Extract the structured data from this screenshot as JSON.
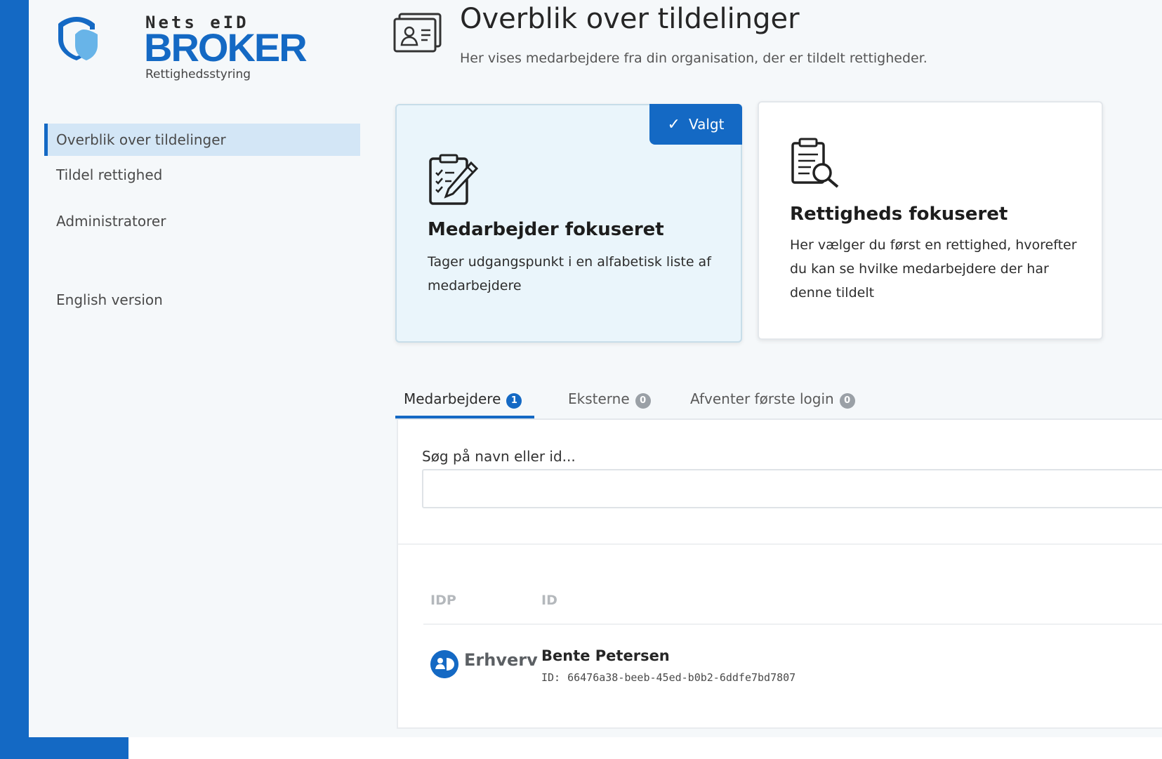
{
  "brand": {
    "top_text": "Nets eID",
    "name": "BROKER",
    "subtitle": "Rettighedsstyring",
    "color": "#1469c4"
  },
  "sidebar": {
    "items": [
      {
        "label": "Overblik over tildelinger",
        "active": true
      },
      {
        "label": "Tildel rettighed",
        "active": false
      },
      {
        "label": "Administratorer",
        "active": false
      },
      {
        "label": "English version",
        "active": false
      }
    ]
  },
  "header": {
    "icon": "id-card-icon",
    "title": "Overblik over tildelinger",
    "subtitle": "Her vises medarbejdere fra din organisation, der er tildelt rettigheder."
  },
  "modes": [
    {
      "icon": "clipboard-pen-icon",
      "title": "Medarbejder fokuseret",
      "description": "Tager udgangspunkt i en alfabetisk liste af medarbejdere",
      "selected": true,
      "badge": "Valgt"
    },
    {
      "icon": "clipboard-search-icon",
      "title": "Rettigheds fokuseret",
      "description": "Her vælger du først en rettighed, hvorefter du kan se hvilke medarbejdere der har denne tildelt",
      "selected": false
    }
  ],
  "tabs": [
    {
      "label": "Medarbejdere",
      "count": "1",
      "active": true
    },
    {
      "label": "Eksterne",
      "count": "0",
      "active": false
    },
    {
      "label": "Afventer første login",
      "count": "0",
      "active": false
    }
  ],
  "search": {
    "label": "Søg på navn eller id...",
    "value": ""
  },
  "table": {
    "columns": [
      "IDP",
      "ID"
    ],
    "rows": [
      {
        "idp": "Erhverv",
        "idp_icon": "mitid-erhverv-icon",
        "name": "Bente Petersen",
        "id_prefix": "ID:",
        "id": "66476a38-beeb-45ed-b0b2-6ddfe7bd7807"
      }
    ]
  },
  "colors": {
    "accent": "#1469c4",
    "selected_card_bg": "#eaf5fb",
    "active_nav_bg": "#d3e6f6"
  }
}
